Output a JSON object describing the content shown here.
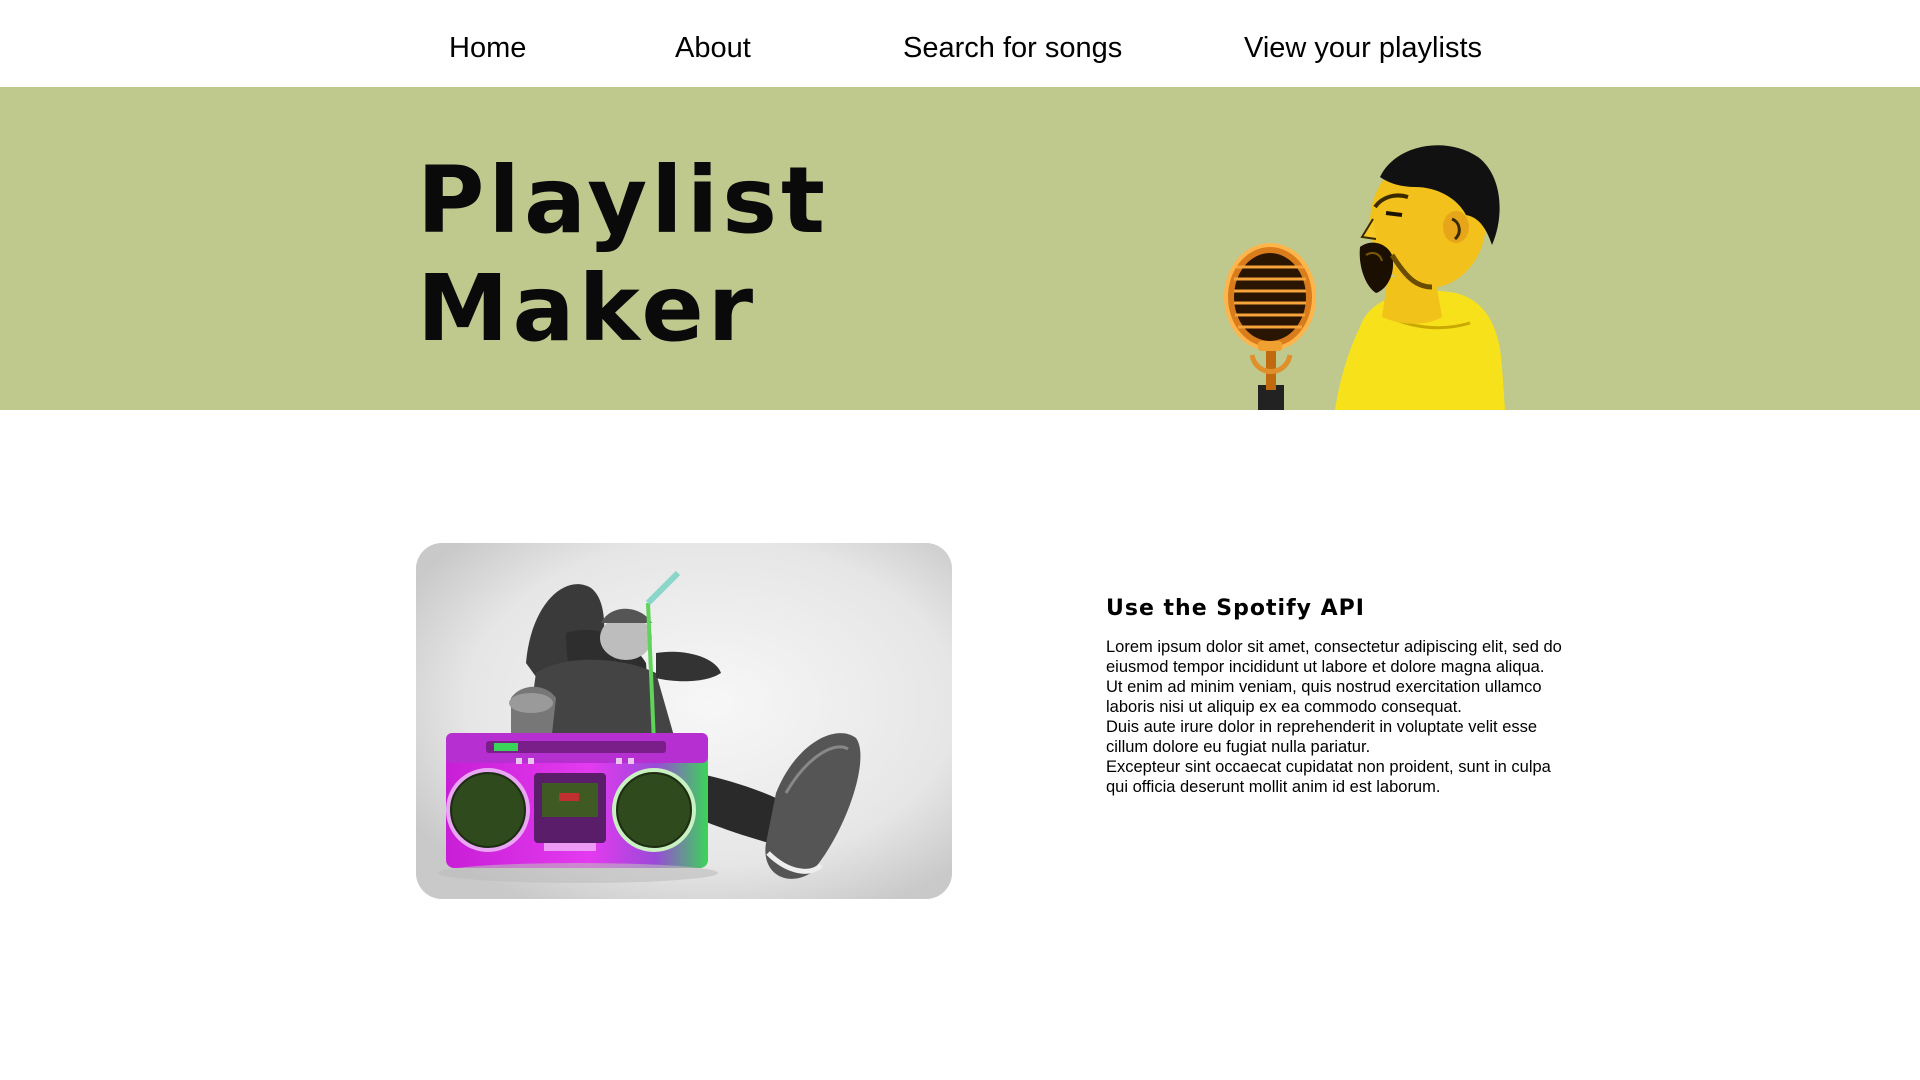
{
  "nav": {
    "items": [
      {
        "label": "Home"
      },
      {
        "label": "About"
      },
      {
        "label": "Search for songs"
      },
      {
        "label": "View your playlists"
      }
    ]
  },
  "hero": {
    "title_line1": "Playlist",
    "title_line2": "Maker",
    "background_color": "#bfc98e",
    "image_icon": "singer-with-microphone"
  },
  "feature": {
    "image_icon": "boombox-photo",
    "heading": "Use the Spotify API",
    "paragraphs": [
      "Lorem ipsum dolor sit amet, consectetur adipiscing elit, sed do eiusmod tempor incididunt ut labore et dolore magna aliqua.",
      "Ut enim ad minim veniam, quis nostrud exercitation ullamco laboris nisi ut aliquip ex ea commodo consequat.",
      "Duis aute irure dolor in reprehenderit in voluptate velit esse cillum dolore eu fugiat nulla pariatur.",
      "Excepteur sint occaecat cupidatat non proident, sunt in culpa qui officia deserunt mollit anim id est laborum."
    ]
  }
}
